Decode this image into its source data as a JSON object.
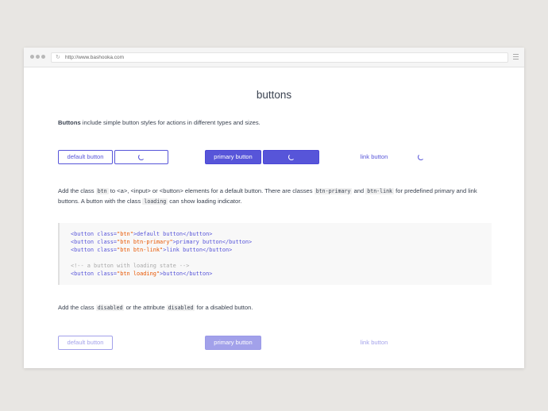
{
  "browser": {
    "url": "http://www.bashooka.com"
  },
  "page": {
    "title": "buttons",
    "intro_bold": "Buttons",
    "intro_rest": " include simple button styles for actions in different types and sizes.",
    "row1": {
      "default_label": "default button",
      "primary_label": "primary button",
      "link_label": "link button"
    },
    "desc": {
      "t1": "Add the class ",
      "c1": "btn",
      "t2": " to <a>, <input> or <button> elements for a default button. There are classes ",
      "c2": "btn-primary",
      "t3": " and ",
      "c3": "btn-link",
      "t4": " for predefined primary and link buttons. A button with the class ",
      "c4": "loading",
      "t5": " can show loading indicator."
    },
    "code": {
      "l1a": "<button class=",
      "l1b": "\"btn\"",
      "l1c": ">default button</button>",
      "l2a": "<button class=",
      "l2b": "\"btn btn-primary\"",
      "l2c": ">primary button</button>",
      "l3a": "<button class=",
      "l3b": "\"btn btn-link\"",
      "l3c": ">link button</button>",
      "l4": "<!-- a button with loading state -->",
      "l5a": "<button class=",
      "l5b": "\"btn loading\"",
      "l5c": ">button</button>"
    },
    "disabled_desc": {
      "t1": "Add the class ",
      "c1": "disabled",
      "t2": " or the attribute ",
      "c2": "disabled",
      "t3": " for a disabled button."
    },
    "row2": {
      "default_label": "default button",
      "primary_label": "primary button",
      "link_label": "link button"
    }
  },
  "colors": {
    "accent": "#5755d9",
    "string": "#e85600"
  },
  "icons": {
    "reload": "reload-icon",
    "menu": "hamburger-menu-icon",
    "spinner": "loading-spinner-icon"
  }
}
